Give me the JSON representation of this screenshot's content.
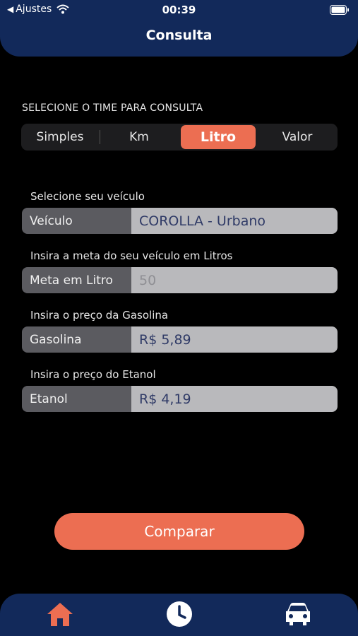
{
  "status_bar": {
    "back_label": "Ajustes",
    "time": "00:39"
  },
  "header": {
    "title": "Consulta"
  },
  "selector": {
    "label": "SELECIONE O TIME PARA CONSULTA",
    "options": [
      "Simples",
      "Km",
      "Litro",
      "Valor"
    ],
    "selected": "Litro"
  },
  "form": {
    "vehicle": {
      "label": "Selecione seu veículo",
      "name": "Veículo",
      "value": "COROLLA - Urbano"
    },
    "goal": {
      "label": "Insira a meta do seu veículo em Litros",
      "name": "Meta em Litro",
      "placeholder": "50"
    },
    "gasoline": {
      "label": "Insira o preço da Gasolina",
      "name": "Gasolina",
      "value": "R$ 5,89"
    },
    "ethanol": {
      "label": "Insira o preço do Etanol",
      "name": "Etanol",
      "value": "R$ 4,19"
    }
  },
  "compare_label": "Comparar",
  "tabbar": {
    "items": [
      {
        "icon": "home-icon",
        "active": true
      },
      {
        "icon": "clock-icon",
        "active": false
      },
      {
        "icon": "car-icon",
        "active": false
      }
    ]
  },
  "colors": {
    "accent": "#ec6e52",
    "navy": "#12295a",
    "background": "#000000"
  }
}
